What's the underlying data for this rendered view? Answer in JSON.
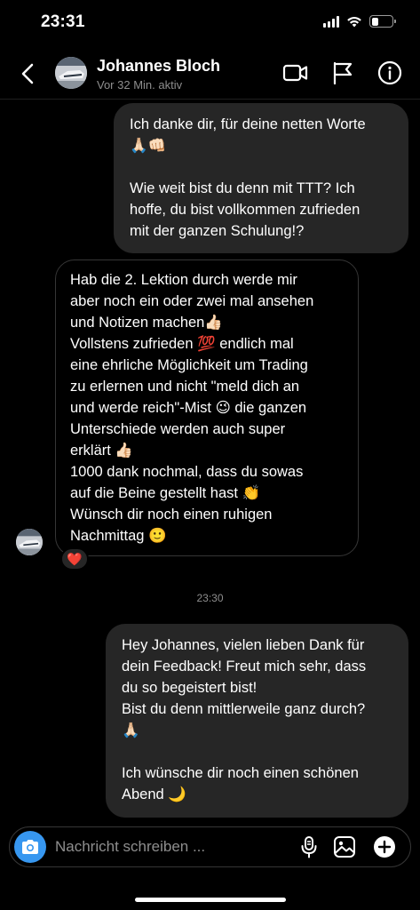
{
  "status_bar": {
    "time": "23:31",
    "battery_level": 0.35
  },
  "header": {
    "contact_name": "Johannes Bloch",
    "contact_status": "Vor 32 Min. aktiv",
    "icons": [
      "back-chevron-icon",
      "video-camera-icon",
      "flag-icon",
      "info-icon"
    ]
  },
  "messages": [
    {
      "direction": "sent",
      "text": "Ich danke dir, für deine netten Worte\n🙏🏻👊🏻\n\nWie weit bist du denn mit TTT? Ich\nhoffe, du bist vollkommen zufrieden\nmit der ganzen Schulung!?"
    },
    {
      "direction": "received",
      "text": "Hab die 2. Lektion durch werde mir\naber noch ein oder zwei mal ansehen\nund Notizen machen👍🏻\nVollstens zufrieden 💯 endlich mal\neine ehrliche Möglichkeit um Trading\nzu erlernen und nicht \"meld dich an\nund werde reich\"-Mist 😉 die ganzen\nUnterschiede werden auch super\nerklärt 👍🏻\n1000 dank nochmal, dass du sowas\nauf die Beine gestellt hast 👏\nWünsch dir noch einen ruhigen\nNachmittag 🙂",
      "reaction": "❤️"
    },
    {
      "direction": "timestamp",
      "text": "23:30"
    },
    {
      "direction": "sent",
      "text": "Hey Johannes, vielen lieben Dank für\ndein Feedback! Freut mich sehr, dass\ndu so begeistert bist!\nBist du denn mittlerweile ganz durch?\n🙏🏻\n\nIch wünsche dir noch einen schönen\nAbend 🌙"
    }
  ],
  "composer": {
    "placeholder": "Nachricht schreiben ...",
    "icons": [
      "camera-icon",
      "microphone-icon",
      "gallery-icon",
      "plus-icon"
    ]
  },
  "colors": {
    "background": "#000000",
    "sent_bubble": "#262626",
    "accent": "#3797f0",
    "muted_text": "#8e8e8e"
  }
}
